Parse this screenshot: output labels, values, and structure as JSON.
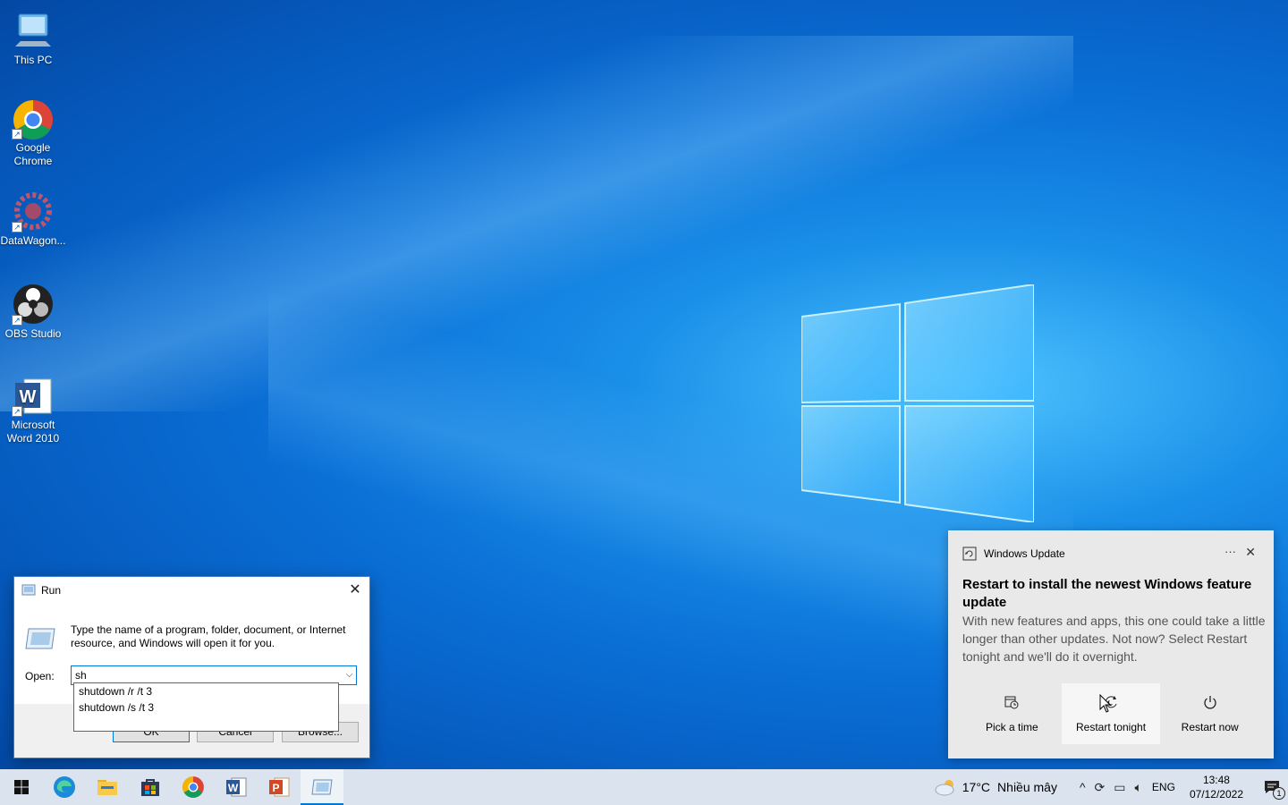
{
  "desktop": {
    "icons": [
      {
        "label": "This PC"
      },
      {
        "label": "Google Chrome"
      },
      {
        "label": "DataWagon..."
      },
      {
        "label": "OBS Studio"
      },
      {
        "label": "Microsoft Word 2010"
      }
    ]
  },
  "run_dialog": {
    "title": "Run",
    "close_glyph": "✕",
    "description": "Type the name of a program, folder, document, or Internet resource, and Windows will open it for you.",
    "open_label": "Open:",
    "input_value": "sh",
    "ok_label": "OK",
    "cancel_label": "Cancel",
    "browse_label": "Browse...",
    "suggestions": [
      "shutdown /r /t 3",
      "shutdown /s /t 3"
    ]
  },
  "toast": {
    "app_name": "Windows Update",
    "more_glyph": "···",
    "close_glyph": "✕",
    "title": "Restart to install the newest Windows feature update",
    "body": "With new features and apps, this one could take a little longer than other updates. Not now? Select Restart tonight and we'll do it overnight.",
    "actions": [
      {
        "label": "Pick a time"
      },
      {
        "label": "Restart tonight"
      },
      {
        "label": "Restart now"
      }
    ]
  },
  "taskbar": {
    "pinned": [
      "start-icon",
      "edge-icon",
      "file-explorer-icon",
      "store-icon",
      "chrome-icon",
      "word-icon",
      "powerpoint-icon",
      "run-icon"
    ],
    "weather_temp": "17°C",
    "weather_text": "Nhiều mây",
    "language": "ENG",
    "time": "13:48",
    "date": "07/12/2022",
    "notification_count": "1"
  },
  "colors": {
    "accent": "#0078d7",
    "taskbar": "#dbe4ee",
    "toast_bg": "#e9e9e9"
  }
}
